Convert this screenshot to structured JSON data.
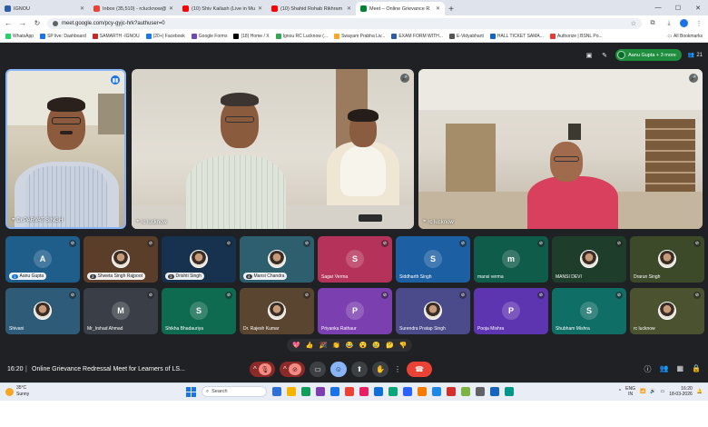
{
  "browser": {
    "tabs": [
      {
        "title": "IGNOU",
        "color": "#2a5caa"
      },
      {
        "title": "Inbox (35,510) - rclucknow@ignou",
        "color": "#ea4335"
      },
      {
        "title": "(10) Shiv Kailash (Live in Mumb",
        "color": "#ff0000"
      },
      {
        "title": "(10) Shahid Rohab Rikhram Si",
        "color": "#ff0000"
      },
      {
        "title": "Meet – Online Grievance R",
        "color": "#00832d",
        "active": true
      }
    ],
    "url": "meet.google.com/pcy-gyjc-hrk?authuser=0",
    "bookmarks": [
      {
        "label": "WhatsApp",
        "color": "#25d366"
      },
      {
        "label": "SP live: Dashboard",
        "color": "#1a73e8"
      },
      {
        "label": "SAMARTH -IGNOU",
        "color": "#c62828"
      },
      {
        "label": "(20+) Facebook",
        "color": "#1877f2"
      },
      {
        "label": "Google Forms",
        "color": "#7248b9"
      },
      {
        "label": "(18) Home / X",
        "color": "#000000"
      },
      {
        "label": "Ignou RC Lucknow (...",
        "color": "#34a853"
      },
      {
        "label": "Swayam Prabha Liv...",
        "color": "#f9a825"
      },
      {
        "label": "EXAM FORM WITH...",
        "color": "#2a5caa"
      },
      {
        "label": "E-Vidyabharti",
        "color": "#555555"
      },
      {
        "label": "HALL TICKET SAMA...",
        "color": "#1565c0"
      },
      {
        "label": "Authorize | BSNL Po...",
        "color": "#e53935"
      }
    ],
    "all_bookmarks": "All Bookmarks"
  },
  "meet": {
    "host_chip": "Aanu Gupta + 3 more",
    "participant_count": "21",
    "main_videos": [
      {
        "label": "Dr.PARVAT SINGH"
      },
      {
        "label": "rc lucknow"
      },
      {
        "label": "rc lucknow"
      }
    ],
    "tiles": [
      {
        "name": "Aanu Gupta",
        "badge": "1",
        "initial": "A",
        "color": "#1f5d8a",
        "chip": true
      },
      {
        "name": "Shweta Singh Rajpoot",
        "badge": "2",
        "photo": true,
        "color": "#5b3e2a",
        "chip": true
      },
      {
        "name": "Drishti Singh",
        "badge": "3",
        "photo": true,
        "color": "#16324f",
        "chip": true
      },
      {
        "name": "Mansi Chandra",
        "badge": "4",
        "photo": true,
        "color": "#2d5f6e",
        "chip": true
      },
      {
        "name": "Sagar Verma",
        "initial": "S",
        "color": "#b5335a"
      },
      {
        "name": "Siddharth Singh",
        "initial": "S",
        "color": "#1d5fa3"
      },
      {
        "name": "mansi verma",
        "initial": "m",
        "color": "#0f5c4a"
      },
      {
        "name": "MANSI DEVI",
        "photo": true,
        "color": "#1f3d2b"
      },
      {
        "name": "Drarun Singh",
        "photo": true,
        "color": "#3d4a2a"
      },
      {
        "name": "Shivani",
        "photo": true,
        "color": "#2e5c78"
      },
      {
        "name": "Mr_Irshad Ahmad",
        "initial": "M",
        "color": "#3a3f47"
      },
      {
        "name": "Shikha Bhadauriya",
        "initial": "S",
        "color": "#0e6b4f"
      },
      {
        "name": "Dr. Rajesh Kumar",
        "photo": true,
        "color": "#5a4530"
      },
      {
        "name": "Priyanka Rathaur",
        "initial": "P",
        "color": "#7b3fb0"
      },
      {
        "name": "Surendra Pratap Singh",
        "photo": true,
        "color": "#4b4a8a"
      },
      {
        "name": "Pooja Mishra",
        "initial": "P",
        "color": "#5e35b1"
      },
      {
        "name": "Shubham Mishra",
        "initial": "S",
        "color": "#0f6e66"
      },
      {
        "name": "rc lucknow",
        "photo": true,
        "color": "#4a5230"
      }
    ],
    "reactions": [
      "💖",
      "👍",
      "🎉",
      "👏",
      "😂",
      "😮",
      "😢",
      "🤔",
      "👎"
    ],
    "time": "16:20",
    "title": "Online Grievance Redressal Meet for Learners of LS..."
  },
  "taskbar": {
    "temp": "35°C",
    "weather": "Sunny",
    "search": "Search",
    "lang": "ENG",
    "region": "IN",
    "time": "16:20",
    "date": "18-03-2026",
    "apps": [
      "#2f6fd6",
      "#f4b400",
      "#0f9d58",
      "#7b3fb0",
      "#1a73e8",
      "#ea4335",
      "#e91e63",
      "#0f6fd6",
      "#0aa67a",
      "#2962ff",
      "#f57c00",
      "#1e88e5",
      "#d32f2f",
      "#7cb342",
      "#5f6368",
      "#1565c0",
      "#009688"
    ]
  }
}
